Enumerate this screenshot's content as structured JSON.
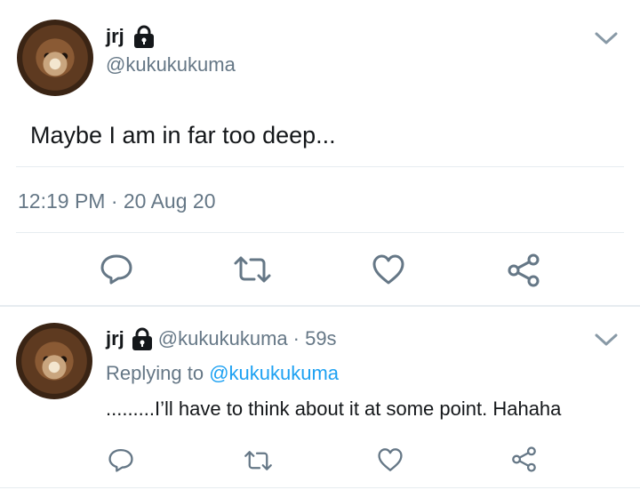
{
  "main_tweet": {
    "display_name": "jrj",
    "handle": "@kukukukuma",
    "text": "Maybe I am in far too deep...",
    "timestamp": "12:19 PM · 20 Aug 20",
    "actions": [
      "reply-icon",
      "retweet-icon",
      "like-icon",
      "share-icon"
    ]
  },
  "reply_tweet": {
    "display_name": "jrj",
    "handle": "@kukukukuma",
    "time_ago": "· 59s",
    "replying_prefix": "Replying to",
    "replying_handle": "@kukukukuma",
    "text": ".........I’ll have to think about it at some point. Hahaha",
    "actions": [
      "reply-icon",
      "retweet-icon",
      "like-icon",
      "share-icon"
    ]
  },
  "colors": {
    "primary_text": "#14171a",
    "secondary_text": "#657786",
    "link": "#1da1f2",
    "divider": "#e6ecf0"
  }
}
